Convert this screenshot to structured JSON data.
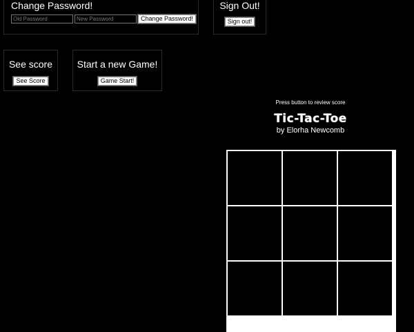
{
  "change_password": {
    "title": "Change Password!",
    "old_placeholder": "Old Password",
    "new_placeholder": "New Password",
    "button": "Change Password!"
  },
  "sign_out": {
    "title": "Sign Out!",
    "button": "Sign out!"
  },
  "see_score": {
    "title": "See score",
    "button": "See Score"
  },
  "new_game": {
    "title": "Start a new Game!",
    "button": "Game Start!"
  },
  "game": {
    "score_message": "Press button to review score",
    "title": "Tic-Tac-Toe",
    "byline": "by Elorha Newcomb",
    "cells": [
      "",
      "",
      "",
      "",
      "",
      "",
      "",
      "",
      ""
    ]
  },
  "colors": {
    "background": "#000000",
    "text": "#ffffff",
    "board_lines": "#ffffff"
  }
}
